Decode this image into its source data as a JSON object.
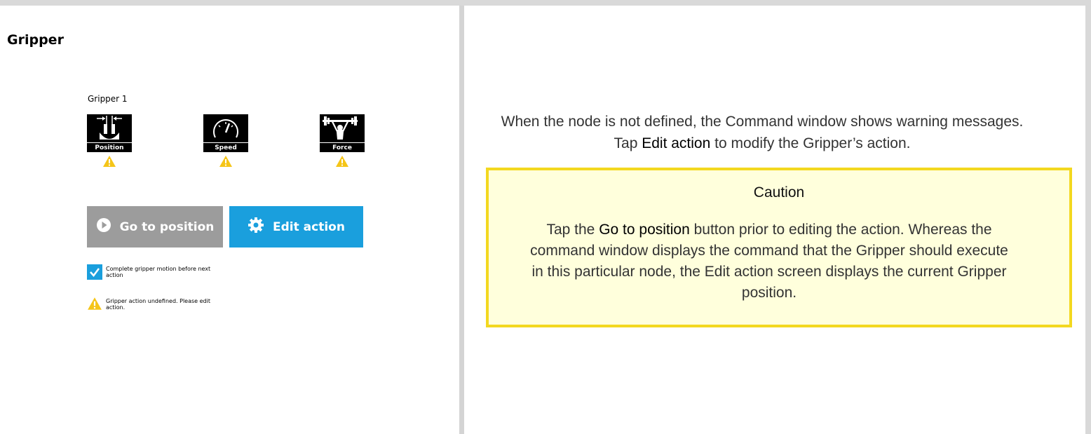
{
  "left": {
    "section_title": "Gripper",
    "gripper_name": "Gripper 1",
    "params": [
      {
        "label": "Position",
        "icon": "gripper-position-icon"
      },
      {
        "label": "Speed",
        "icon": "speedometer-icon"
      },
      {
        "label": "Force",
        "icon": "weightlifter-icon"
      }
    ],
    "go_button": "Go to position",
    "edit_button": "Edit action",
    "checkbox_label": "Complete gripper motion before next action",
    "warning_text": "Gripper action undefined. Please edit action.",
    "colors": {
      "accent": "#1a9fdd",
      "disabled": "#9c9c9c",
      "warning": "#f5c518"
    }
  },
  "right": {
    "desc_part1": "When the node is not defined, the Command window shows warning messages. Tap ",
    "desc_strong": "Edit action",
    "desc_part2": " to modify the Gripper’s action.",
    "caution_title": "Caution",
    "caution_part1": "Tap the ",
    "caution_strong": "Go to position",
    "caution_part2": " button prior to editing the action. Whereas the command window displays the command that the Gripper should execute in this particular node, the Edit action screen displays the current Gripper position.",
    "colors": {
      "caution_bg": "#ffffdc",
      "caution_border": "#f3d81f"
    }
  }
}
